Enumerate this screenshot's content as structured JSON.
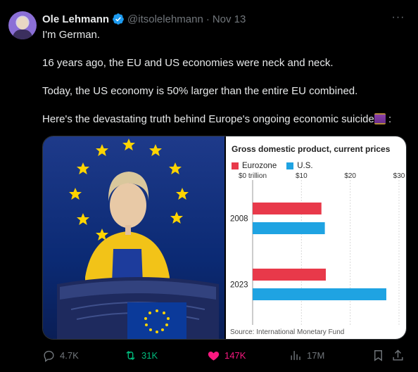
{
  "tweet": {
    "name": "Ole Lehmann",
    "handle": "@itsolelehmann",
    "separator": "·",
    "date": "Nov 13",
    "more": "···",
    "lines": [
      "I'm German.",
      "16 years ago, the EU and US economies were neck and neck.",
      "Today, the US economy is 50% larger than the entire EU combined.",
      "Here's the devastating truth behind Europe's ongoing economic suicide"
    ],
    "trailing": ":",
    "emoji": "spool-of-thread"
  },
  "actions": {
    "replies": "4.7K",
    "retweets": "31K",
    "likes": "147K",
    "views": "17M"
  },
  "colors": {
    "eurozone": "#e8394a",
    "us": "#1fa3e2",
    "like": "#f91880",
    "retweet": "#00ba7c",
    "verified": "#1d9bf0"
  },
  "chart_data": {
    "type": "bar",
    "orientation": "horizontal",
    "title": "Gross domestic product, current prices",
    "categories": [
      "2008",
      "2023"
    ],
    "series": [
      {
        "name": "Eurozone",
        "values": [
          14.1,
          15.0
        ]
      },
      {
        "name": "U.S.",
        "values": [
          14.8,
          27.4
        ]
      }
    ],
    "xticks": [
      "$0 trillion",
      "$10",
      "$20",
      "$30"
    ],
    "xlim": [
      0,
      30
    ],
    "source": "Source: International Monetary Fund",
    "legend": "top-left"
  }
}
